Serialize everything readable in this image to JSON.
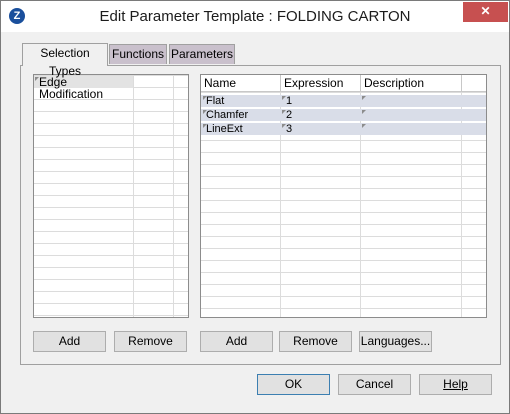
{
  "window": {
    "title": "Edit Parameter Template : FOLDING CARTON",
    "close_glyph": "✕"
  },
  "tabs": [
    {
      "label": "Selection Types",
      "active": true
    },
    {
      "label": "Functions",
      "active": false
    },
    {
      "label": "Parameters",
      "active": false
    }
  ],
  "selection_list": {
    "items": [
      "Edge Modification"
    ]
  },
  "param_grid": {
    "columns": [
      "Name",
      "Expression",
      "Description"
    ],
    "rows": [
      {
        "name": "Flat",
        "expression": "1",
        "description": ""
      },
      {
        "name": "Chamfer",
        "expression": "2",
        "description": ""
      },
      {
        "name": "LineExt",
        "expression": "3",
        "description": ""
      }
    ]
  },
  "left_buttons": {
    "add": "Add",
    "remove": "Remove"
  },
  "right_buttons": {
    "add": "Add",
    "remove": "Remove",
    "languages": "Languages..."
  },
  "dialog_buttons": {
    "ok": "OK",
    "cancel": "Cancel",
    "help": "Help"
  }
}
